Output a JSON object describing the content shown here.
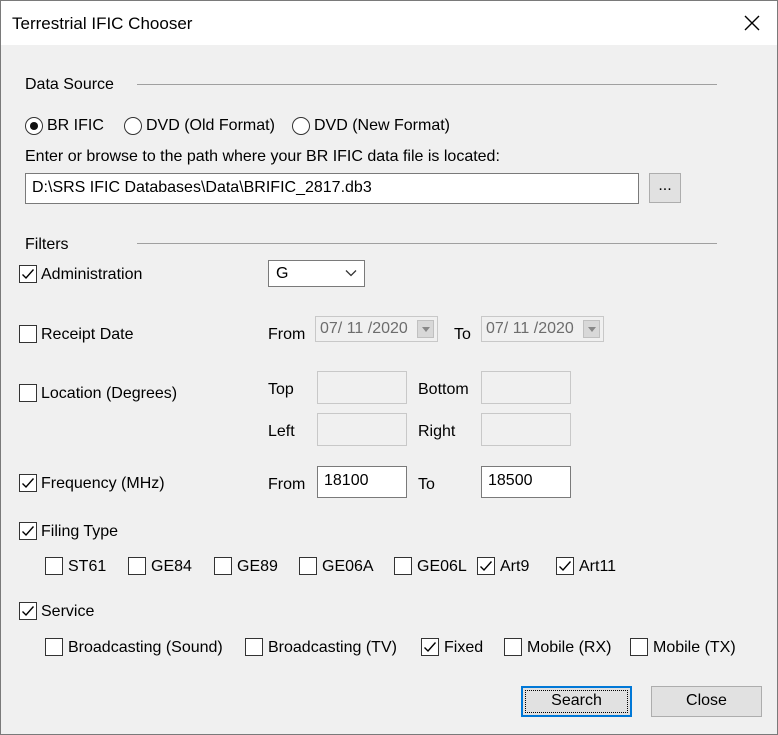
{
  "window": {
    "title": "Terrestrial IFIC Chooser"
  },
  "data_source": {
    "heading": "Data Source",
    "options": [
      {
        "label": "BR IFIC",
        "selected": true
      },
      {
        "label": "DVD (Old Format)",
        "selected": false
      },
      {
        "label": "DVD (New Format)",
        "selected": false
      }
    ],
    "path_prompt": "Enter or browse to the path where your BR IFIC data file is located:",
    "path_value": "D:\\SRS IFIC Databases\\Data\\BRIFIC_2817.db3",
    "browse_label": "..."
  },
  "filters": {
    "heading": "Filters",
    "administration": {
      "label": "Administration",
      "checked": true,
      "value": "G"
    },
    "receipt_date": {
      "label": "Receipt Date",
      "checked": false,
      "from_label": "From",
      "from_value": "07/ 11 /2020",
      "to_label": "To",
      "to_value": "07/ 11 /2020"
    },
    "location": {
      "label": "Location (Degrees)",
      "checked": false,
      "top_label": "Top",
      "bottom_label": "Bottom",
      "left_label": "Left",
      "right_label": "Right"
    },
    "frequency": {
      "label": "Frequency (MHz)",
      "checked": true,
      "from_label": "From",
      "from_value": "18100",
      "to_label": "To",
      "to_value": "18500"
    },
    "filing_type": {
      "label": "Filing Type",
      "checked": true,
      "items": [
        {
          "label": "ST61",
          "checked": false
        },
        {
          "label": "GE84",
          "checked": false
        },
        {
          "label": "GE89",
          "checked": false
        },
        {
          "label": "GE06A",
          "checked": false
        },
        {
          "label": "GE06L",
          "checked": false
        },
        {
          "label": "Art9",
          "checked": true
        },
        {
          "label": "Art11",
          "checked": true
        }
      ]
    },
    "service": {
      "label": "Service",
      "checked": true,
      "items": [
        {
          "label": "Broadcasting (Sound)",
          "checked": false
        },
        {
          "label": "Broadcasting (TV)",
          "checked": false
        },
        {
          "label": "Fixed",
          "checked": true
        },
        {
          "label": "Mobile (RX)",
          "checked": false
        },
        {
          "label": "Mobile (TX)",
          "checked": false
        }
      ]
    }
  },
  "buttons": {
    "search": "Search",
    "close": "Close"
  },
  "icons": {
    "close": "close-icon",
    "check": "checkmark-icon",
    "dropdown": "chevron-down-icon"
  },
  "colors": {
    "accent": "#0078d7",
    "background": "#f0f0f0"
  }
}
